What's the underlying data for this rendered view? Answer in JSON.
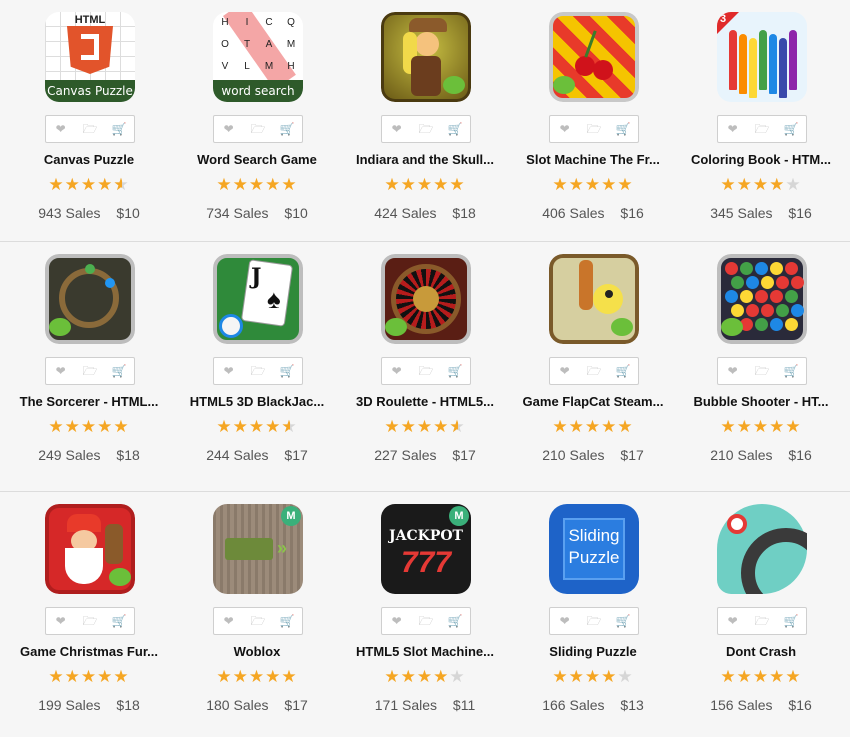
{
  "icons": {
    "heart": "heart-icon",
    "folder": "folder-icon",
    "cart": "cart-icon"
  },
  "colors": {
    "star": "#f5a623",
    "star_empty": "#d6d6d6"
  },
  "products": [
    {
      "title": "Canvas Puzzle",
      "rating": 4.5,
      "sales": "943 Sales",
      "price": "$10",
      "badge": "Canvas Puzzle",
      "logo_text": "HTML",
      "thumb": "canvas"
    },
    {
      "title": "Word Search Game",
      "rating": 5,
      "sales": "734 Sales",
      "price": "$10",
      "badge": "word search",
      "letters": [
        "H",
        "I",
        "C",
        "Q",
        "O",
        "T",
        "A",
        "M",
        "V",
        "L",
        "M",
        "H"
      ],
      "thumb": "word"
    },
    {
      "title": "Indiara and the Skull...",
      "rating": 5,
      "sales": "424 Sales",
      "price": "$18",
      "thumb": "indiara"
    },
    {
      "title": "Slot Machine The Fr...",
      "rating": 5,
      "sales": "406 Sales",
      "price": "$16",
      "thumb": "slot"
    },
    {
      "title": "Coloring Book - HTM...",
      "rating": 4,
      "sales": "345 Sales",
      "price": "$16",
      "badge_num": "3",
      "thumb": "coloring"
    },
    {
      "title": "The Sorcerer - HTML...",
      "rating": 5,
      "sales": "249 Sales",
      "price": "$18",
      "thumb": "sorcerer"
    },
    {
      "title": "HTML5 3D BlackJac...",
      "rating": 4.5,
      "sales": "244 Sales",
      "price": "$17",
      "card_letter": "J",
      "thumb": "blackjack"
    },
    {
      "title": "3D Roulette - HTML5...",
      "rating": 4.5,
      "sales": "227 Sales",
      "price": "$17",
      "thumb": "roulette"
    },
    {
      "title": "Game FlapCat Steam...",
      "rating": 5,
      "sales": "210 Sales",
      "price": "$17",
      "thumb": "flapcat"
    },
    {
      "title": "Bubble Shooter - HT...",
      "rating": 5,
      "sales": "210 Sales",
      "price": "$16",
      "thumb": "bubble"
    },
    {
      "title": "Game Christmas Fur...",
      "rating": 5,
      "sales": "199 Sales",
      "price": "$18",
      "thumb": "christmas"
    },
    {
      "title": "Woblox",
      "rating": 5,
      "sales": "180 Sales",
      "price": "$17",
      "m_badge": "M",
      "thumb": "woblox"
    },
    {
      "title": "HTML5 Slot Machine...",
      "rating": 4,
      "sales": "171 Sales",
      "price": "$11",
      "m_badge": "M",
      "logo_text": "JACKPOT",
      "digits": "777",
      "thumb": "jackpot"
    },
    {
      "title": "Sliding Puzzle",
      "rating": 4,
      "sales": "166 Sales",
      "price": "$13",
      "logo_line1": "Sliding",
      "logo_line2": "Puzzle",
      "thumb": "sliding"
    },
    {
      "title": "Dont Crash",
      "rating": 5,
      "sales": "156 Sales",
      "price": "$16",
      "thumb": "dontcrash"
    }
  ]
}
